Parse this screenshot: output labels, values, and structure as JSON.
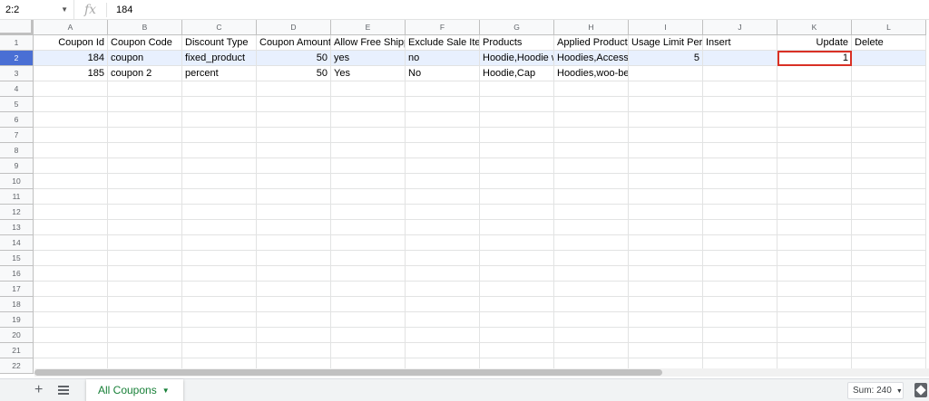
{
  "formula_bar": {
    "name_box": "2:2",
    "fx_symbol": "fx",
    "value": "184"
  },
  "columns": [
    "A",
    "B",
    "C",
    "D",
    "E",
    "F",
    "G",
    "H",
    "I",
    "J",
    "K",
    "L"
  ],
  "rows": [
    {
      "num": "1",
      "cells": [
        "Coupon Id",
        "Coupon Code",
        "Discount Type",
        "Coupon Amount",
        "Allow Free Shipp",
        "Exclude Sale Ite",
        "Products",
        "Applied Product",
        "Usage Limit Per",
        "Insert",
        "Update",
        "Delete"
      ]
    },
    {
      "num": "2",
      "cells": [
        "184",
        "coupon",
        "fixed_product",
        "50",
        "yes",
        "no",
        "Hoodie,Hoodie w",
        "Hoodies,Access",
        "5",
        "",
        "1",
        ""
      ]
    },
    {
      "num": "3",
      "cells": [
        "185",
        "coupon 2",
        "percent",
        "50",
        "Yes",
        "No",
        "Hoodie,Cap",
        "Hoodies,woo-beanie",
        "",
        "",
        "",
        ""
      ]
    },
    {
      "num": "4",
      "cells": [
        "",
        "",
        "",
        "",
        "",
        "",
        "",
        "",
        "",
        "",
        "",
        ""
      ]
    },
    {
      "num": "5",
      "cells": [
        "",
        "",
        "",
        "",
        "",
        "",
        "",
        "",
        "",
        "",
        "",
        ""
      ]
    },
    {
      "num": "6",
      "cells": [
        "",
        "",
        "",
        "",
        "",
        "",
        "",
        "",
        "",
        "",
        "",
        ""
      ]
    },
    {
      "num": "7",
      "cells": [
        "",
        "",
        "",
        "",
        "",
        "",
        "",
        "",
        "",
        "",
        "",
        ""
      ]
    },
    {
      "num": "8",
      "cells": [
        "",
        "",
        "",
        "",
        "",
        "",
        "",
        "",
        "",
        "",
        "",
        ""
      ]
    },
    {
      "num": "9",
      "cells": [
        "",
        "",
        "",
        "",
        "",
        "",
        "",
        "",
        "",
        "",
        "",
        ""
      ]
    },
    {
      "num": "10",
      "cells": [
        "",
        "",
        "",
        "",
        "",
        "",
        "",
        "",
        "",
        "",
        "",
        ""
      ]
    },
    {
      "num": "11",
      "cells": [
        "",
        "",
        "",
        "",
        "",
        "",
        "",
        "",
        "",
        "",
        "",
        ""
      ]
    },
    {
      "num": "12",
      "cells": [
        "",
        "",
        "",
        "",
        "",
        "",
        "",
        "",
        "",
        "",
        "",
        ""
      ]
    },
    {
      "num": "13",
      "cells": [
        "",
        "",
        "",
        "",
        "",
        "",
        "",
        "",
        "",
        "",
        "",
        ""
      ]
    },
    {
      "num": "14",
      "cells": [
        "",
        "",
        "",
        "",
        "",
        "",
        "",
        "",
        "",
        "",
        "",
        ""
      ]
    },
    {
      "num": "15",
      "cells": [
        "",
        "",
        "",
        "",
        "",
        "",
        "",
        "",
        "",
        "",
        "",
        ""
      ]
    },
    {
      "num": "16",
      "cells": [
        "",
        "",
        "",
        "",
        "",
        "",
        "",
        "",
        "",
        "",
        "",
        ""
      ]
    },
    {
      "num": "17",
      "cells": [
        "",
        "",
        "",
        "",
        "",
        "",
        "",
        "",
        "",
        "",
        "",
        ""
      ]
    },
    {
      "num": "18",
      "cells": [
        "",
        "",
        "",
        "",
        "",
        "",
        "",
        "",
        "",
        "",
        "",
        ""
      ]
    },
    {
      "num": "19",
      "cells": [
        "",
        "",
        "",
        "",
        "",
        "",
        "",
        "",
        "",
        "",
        "",
        ""
      ]
    },
    {
      "num": "20",
      "cells": [
        "",
        "",
        "",
        "",
        "",
        "",
        "",
        "",
        "",
        "",
        "",
        ""
      ]
    },
    {
      "num": "21",
      "cells": [
        "",
        "",
        "",
        "",
        "",
        "",
        "",
        "",
        "",
        "",
        "",
        ""
      ]
    },
    {
      "num": "22",
      "cells": [
        "",
        "",
        "",
        "",
        "",
        "",
        "",
        "",
        "",
        "",
        "",
        ""
      ]
    }
  ],
  "numeric_columns": [
    0,
    3,
    8,
    10
  ],
  "selected_row": "2",
  "active_cell": {
    "row": "2",
    "col": "K"
  },
  "sheet_tab": {
    "label": "All Coupons"
  },
  "status": {
    "sum": "Sum: 240"
  },
  "colors": {
    "selection": "#4a6fd4",
    "active_outline": "#d93025",
    "tab_text": "#188038"
  }
}
